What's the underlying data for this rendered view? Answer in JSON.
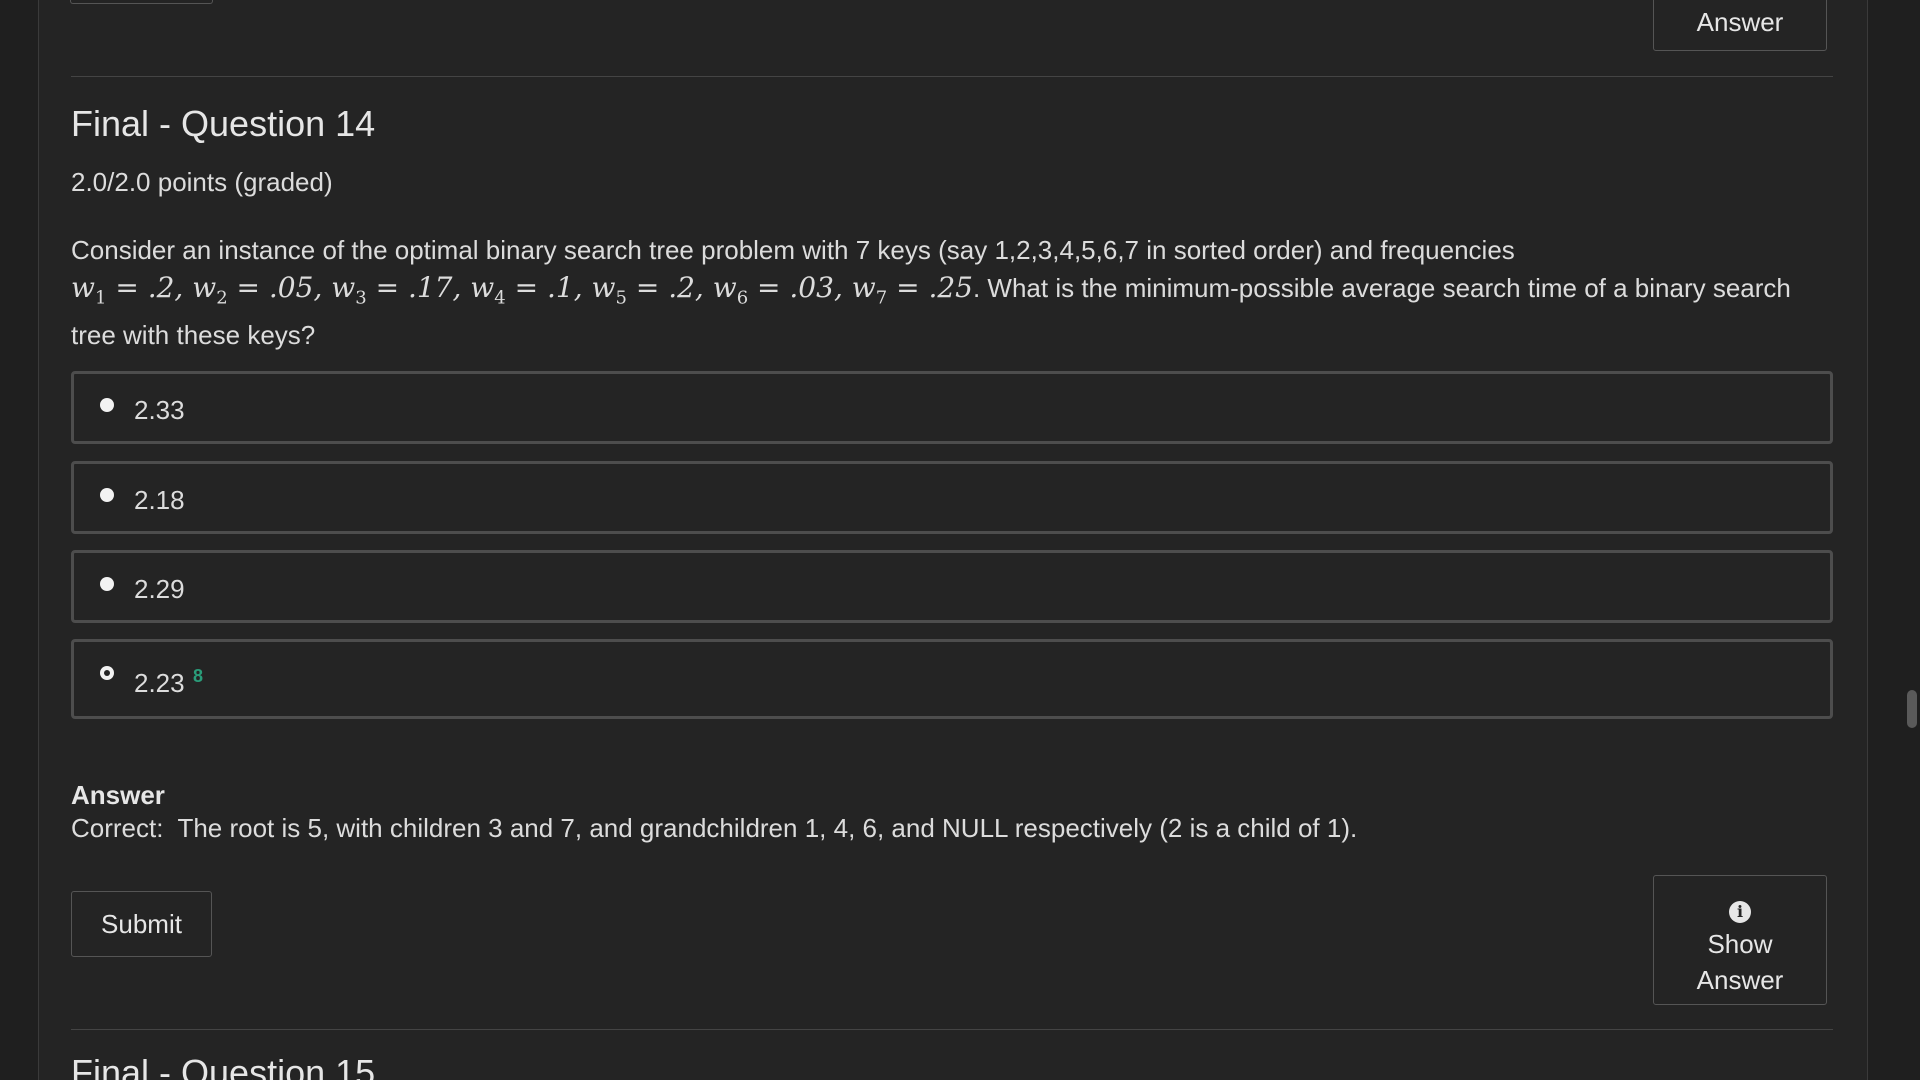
{
  "top": {
    "answer_label": "Answer"
  },
  "question": {
    "title": "Final - Question 14",
    "score": "2.0/2.0 points (graded)",
    "text_intro": "Consider an instance of the optimal binary search tree problem with 7 keys (say 1,2,3,4,5,6,7 in sorted order) and frequencies",
    "weights": [
      {
        "var": "w",
        "sub": "1",
        "val": ".2"
      },
      {
        "var": "w",
        "sub": "2",
        "val": ".05"
      },
      {
        "var": "w",
        "sub": "3",
        "val": ".17"
      },
      {
        "var": "w",
        "sub": "4",
        "val": ".1"
      },
      {
        "var": "w",
        "sub": "5",
        "val": ".2"
      },
      {
        "var": "w",
        "sub": "6",
        "val": ".03"
      },
      {
        "var": "w",
        "sub": "7",
        "val": ".25"
      }
    ],
    "text_outro": ". What is the minimum-possible average search time of a binary search tree with these keys?"
  },
  "options": [
    {
      "label": "2.33",
      "selected": false
    },
    {
      "label": "2.18",
      "selected": false
    },
    {
      "label": "2.29",
      "selected": false
    },
    {
      "label": "2.23",
      "selected": true,
      "mark": "8"
    }
  ],
  "answer": {
    "heading": "Answer",
    "text": "Correct:  The root is 5, with children 3 and 7, and grandchildren 1, 4, 6, and NULL respectively (2 is a child of 1)."
  },
  "actions": {
    "submit_label": "Submit",
    "show_answer_line1": "Show",
    "show_answer_line2": "Answer",
    "show_answer_icon": "info-icon"
  },
  "next_question": {
    "title": "Final - Question 15"
  }
}
